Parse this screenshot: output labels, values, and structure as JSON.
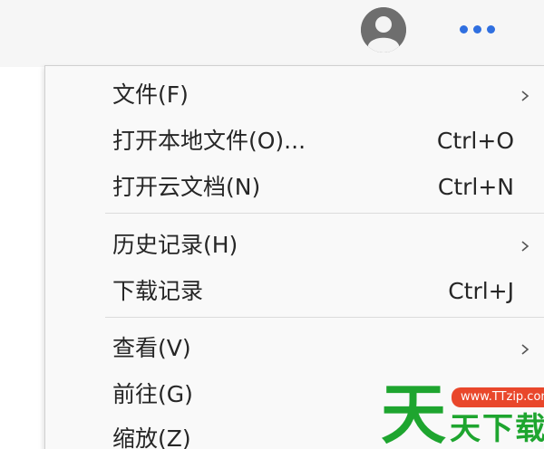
{
  "toolbar": {
    "avatar_icon": "user-avatar-icon",
    "more_icon": "more-dots-icon",
    "accent_color": "#2f6fe0"
  },
  "menu": {
    "items": [
      {
        "label": "文件(F)",
        "shortcut": "",
        "has_submenu": true
      },
      {
        "label": "打开本地文件(O)...",
        "shortcut": "Ctrl+O",
        "has_submenu": false
      },
      {
        "label": "打开云文档(N)",
        "shortcut": "Ctrl+N",
        "has_submenu": false
      },
      {
        "label": "历史记录(H)",
        "shortcut": "",
        "has_submenu": true
      },
      {
        "label": "下载记录",
        "shortcut": "Ctrl+J",
        "has_submenu": false
      },
      {
        "label": "查看(V)",
        "shortcut": "",
        "has_submenu": true
      },
      {
        "label": "前往(G)",
        "shortcut": "",
        "has_submenu": true
      },
      {
        "label": "缩放(Z)",
        "shortcut": "",
        "has_submenu": false
      }
    ]
  },
  "watermark": {
    "big_char": "天",
    "url": "www.TTzip.com",
    "text": "天下载",
    "color": "#1ea52f"
  }
}
